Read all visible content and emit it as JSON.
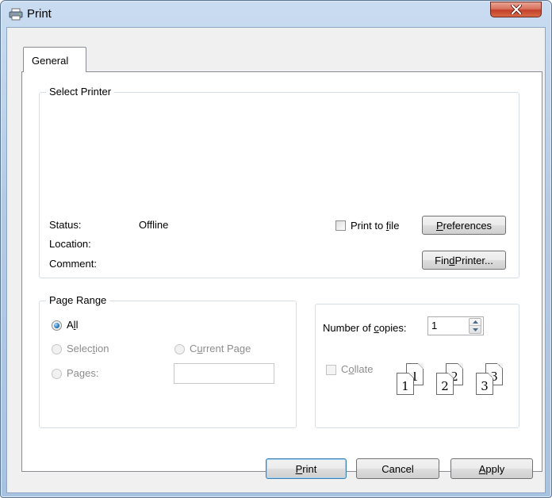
{
  "window": {
    "title": "Print",
    "close_icon": "close-icon"
  },
  "tabs": [
    {
      "label": "General",
      "active": true
    }
  ],
  "select_printer": {
    "legend": "Select Printer",
    "status_label": "Status:",
    "status_value": "Offline",
    "location_label": "Location:",
    "comment_label": "Comment:",
    "print_to_file": {
      "label_pre": "Print to ",
      "label_key": "f",
      "label_post": "ile",
      "checked": false
    },
    "preferences": {
      "label_key": "P",
      "label_post": "references"
    },
    "find_printer": {
      "label_pre": "Fin",
      "label_key": "d",
      "label_post": " Printer..."
    }
  },
  "page_range": {
    "legend": "Page Range",
    "all": {
      "label_pre": "A",
      "label_key": "l",
      "label_post": "l",
      "checked": true
    },
    "selection": {
      "label_pre": "Selec",
      "label_key": "t",
      "label_post": "ion",
      "enabled": false
    },
    "current_page": {
      "label_pre": "C",
      "label_key": "u",
      "label_post": "rrent Page",
      "enabled": false
    },
    "pages": {
      "label_pre": "Pa",
      "label_key": "g",
      "label_post": "es:",
      "enabled": false,
      "value": ""
    }
  },
  "copies": {
    "label_pre": "Number of ",
    "label_key": "c",
    "label_post": "opies:",
    "value": "1",
    "collate": {
      "label_pre": "C",
      "label_key": "o",
      "label_post": "llate",
      "checked": false,
      "enabled": false
    },
    "collate_pages": [
      {
        "a": "1",
        "b": "1"
      },
      {
        "a": "2",
        "b": "2"
      },
      {
        "a": "3",
        "b": "3"
      }
    ]
  },
  "footer": {
    "print": {
      "label_key": "P",
      "label_post": "rint"
    },
    "cancel": {
      "label": "Cancel"
    },
    "apply": {
      "label_key": "A",
      "label_post": "pply"
    }
  },
  "colors": {
    "accent": "#2b74b5",
    "close_button": "#c4402a"
  }
}
